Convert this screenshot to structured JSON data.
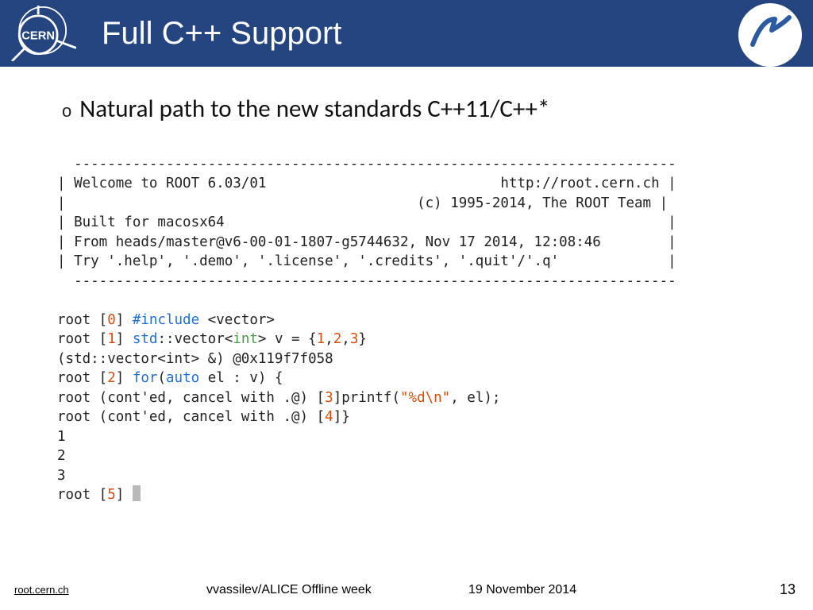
{
  "header": {
    "title": "Full C++ Support"
  },
  "bullet": {
    "marker": "o",
    "text": "Natural path to the new standards C++11/C++*"
  },
  "terminal": {
    "dash_top": "  ------------------------------------------------------------------------",
    "welcome_l": "| Welcome to ROOT 6.03/01",
    "welcome_r": "http://root.cern.ch |",
    "copyright_l": "|",
    "copyright_r": "(c) 1995-2014, The ROOT Team |",
    "built": "| Built for macosx64                                                     |",
    "from": "| From heads/master@v6-00-01-1807-g5744632, Nov 17 2014, 12:08:46        |",
    "try": "| Try '.help', '.demo', '.license', '.credits', '.quit'/'.q'             |",
    "dash_bot": "  ------------------------------------------------------------------------",
    "l0_a": "root [",
    "l0_n": "0",
    "l0_b": "] ",
    "l0_kw": "#include",
    "l0_c": " <vector>",
    "l1_a": "root [",
    "l1_n": "1",
    "l1_b": "] ",
    "l1_kw": "std",
    "l1_c": "::vector<",
    "l1_t": "int",
    "l1_d": "> v = {",
    "l1_e": "1",
    "l1_f": ",",
    "l1_g": "2",
    "l1_h": ",",
    "l1_i": "3",
    "l1_j": "}",
    "l2": "(std::vector<int> &) @0x119f7f058",
    "l3_a": "root [",
    "l3_n": "2",
    "l3_b": "] ",
    "l3_kw": "for",
    "l3_c": "(",
    "l3_kw2": "auto",
    "l3_d": " el : v) {",
    "l4_a": "root (cont'ed, cancel with .@) [",
    "l4_n": "3",
    "l4_b": "]printf(",
    "l4_s": "\"%d\\n\"",
    "l4_c": ", el);",
    "l5_a": "root (cont'ed, cancel with .@) [",
    "l5_n": "4",
    "l5_b": "]}",
    "out1": "1",
    "out2": "2",
    "out3": "3",
    "l6_a": "root [",
    "l6_n": "5",
    "l6_b": "] "
  },
  "footer": {
    "url": "root.cern.ch",
    "center": "vvassilev/ALICE Offline week",
    "date": "19 November 2014",
    "page": "13"
  }
}
